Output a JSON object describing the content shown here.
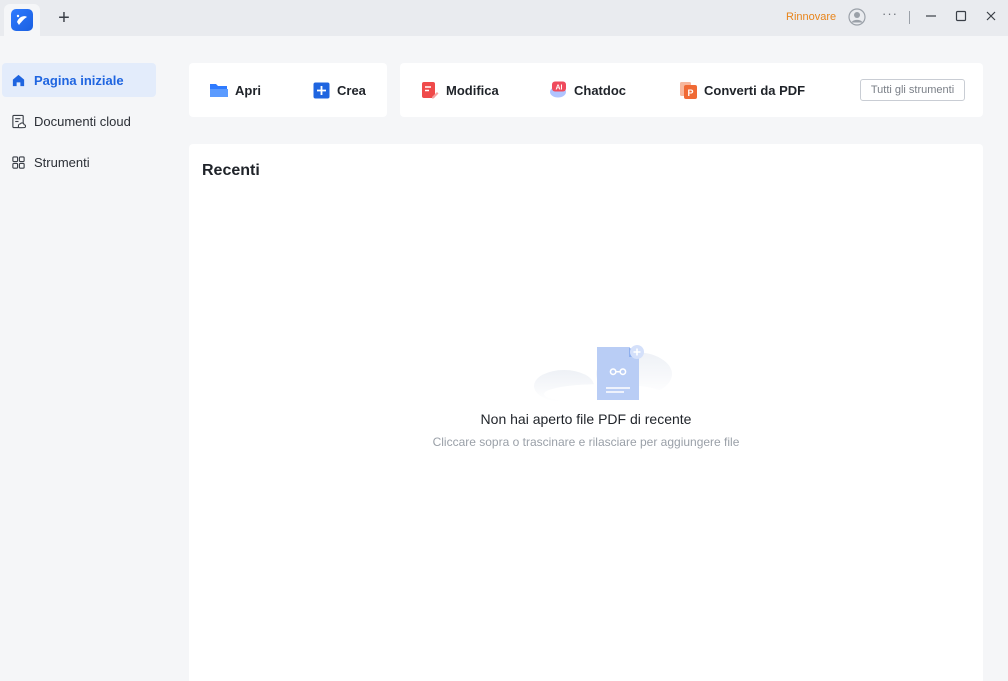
{
  "titlebar": {
    "new_tab_label": "+",
    "renew_label": "Rinnovare",
    "more_label": "···"
  },
  "sidebar": {
    "items": [
      {
        "label": "Pagina iniziale",
        "icon": "home-icon",
        "active": true
      },
      {
        "label": "Documenti cloud",
        "icon": "cloud-doc-icon",
        "active": false
      },
      {
        "label": "Strumenti",
        "icon": "grid-icon",
        "active": false
      }
    ]
  },
  "toolbar": {
    "open_label": "Apri",
    "create_label": "Crea",
    "edit_label": "Modifica",
    "chatdoc_label": "Chatdoc",
    "convert_label": "Converti da PDF",
    "all_tools_label": "Tutti gli strumenti",
    "chatdoc_badge": "AI",
    "convert_badge": "P"
  },
  "recent": {
    "title": "Recenti",
    "empty_title": "Non hai aperto file PDF di recente",
    "empty_subtitle": "Cliccare sopra o trascinare e rilasciare per aggiungere file"
  },
  "colors": {
    "accent": "#1f65e0",
    "renew": "#e8841a",
    "edit_red": "#ef4a4a",
    "convert_orange": "#f06a35"
  }
}
